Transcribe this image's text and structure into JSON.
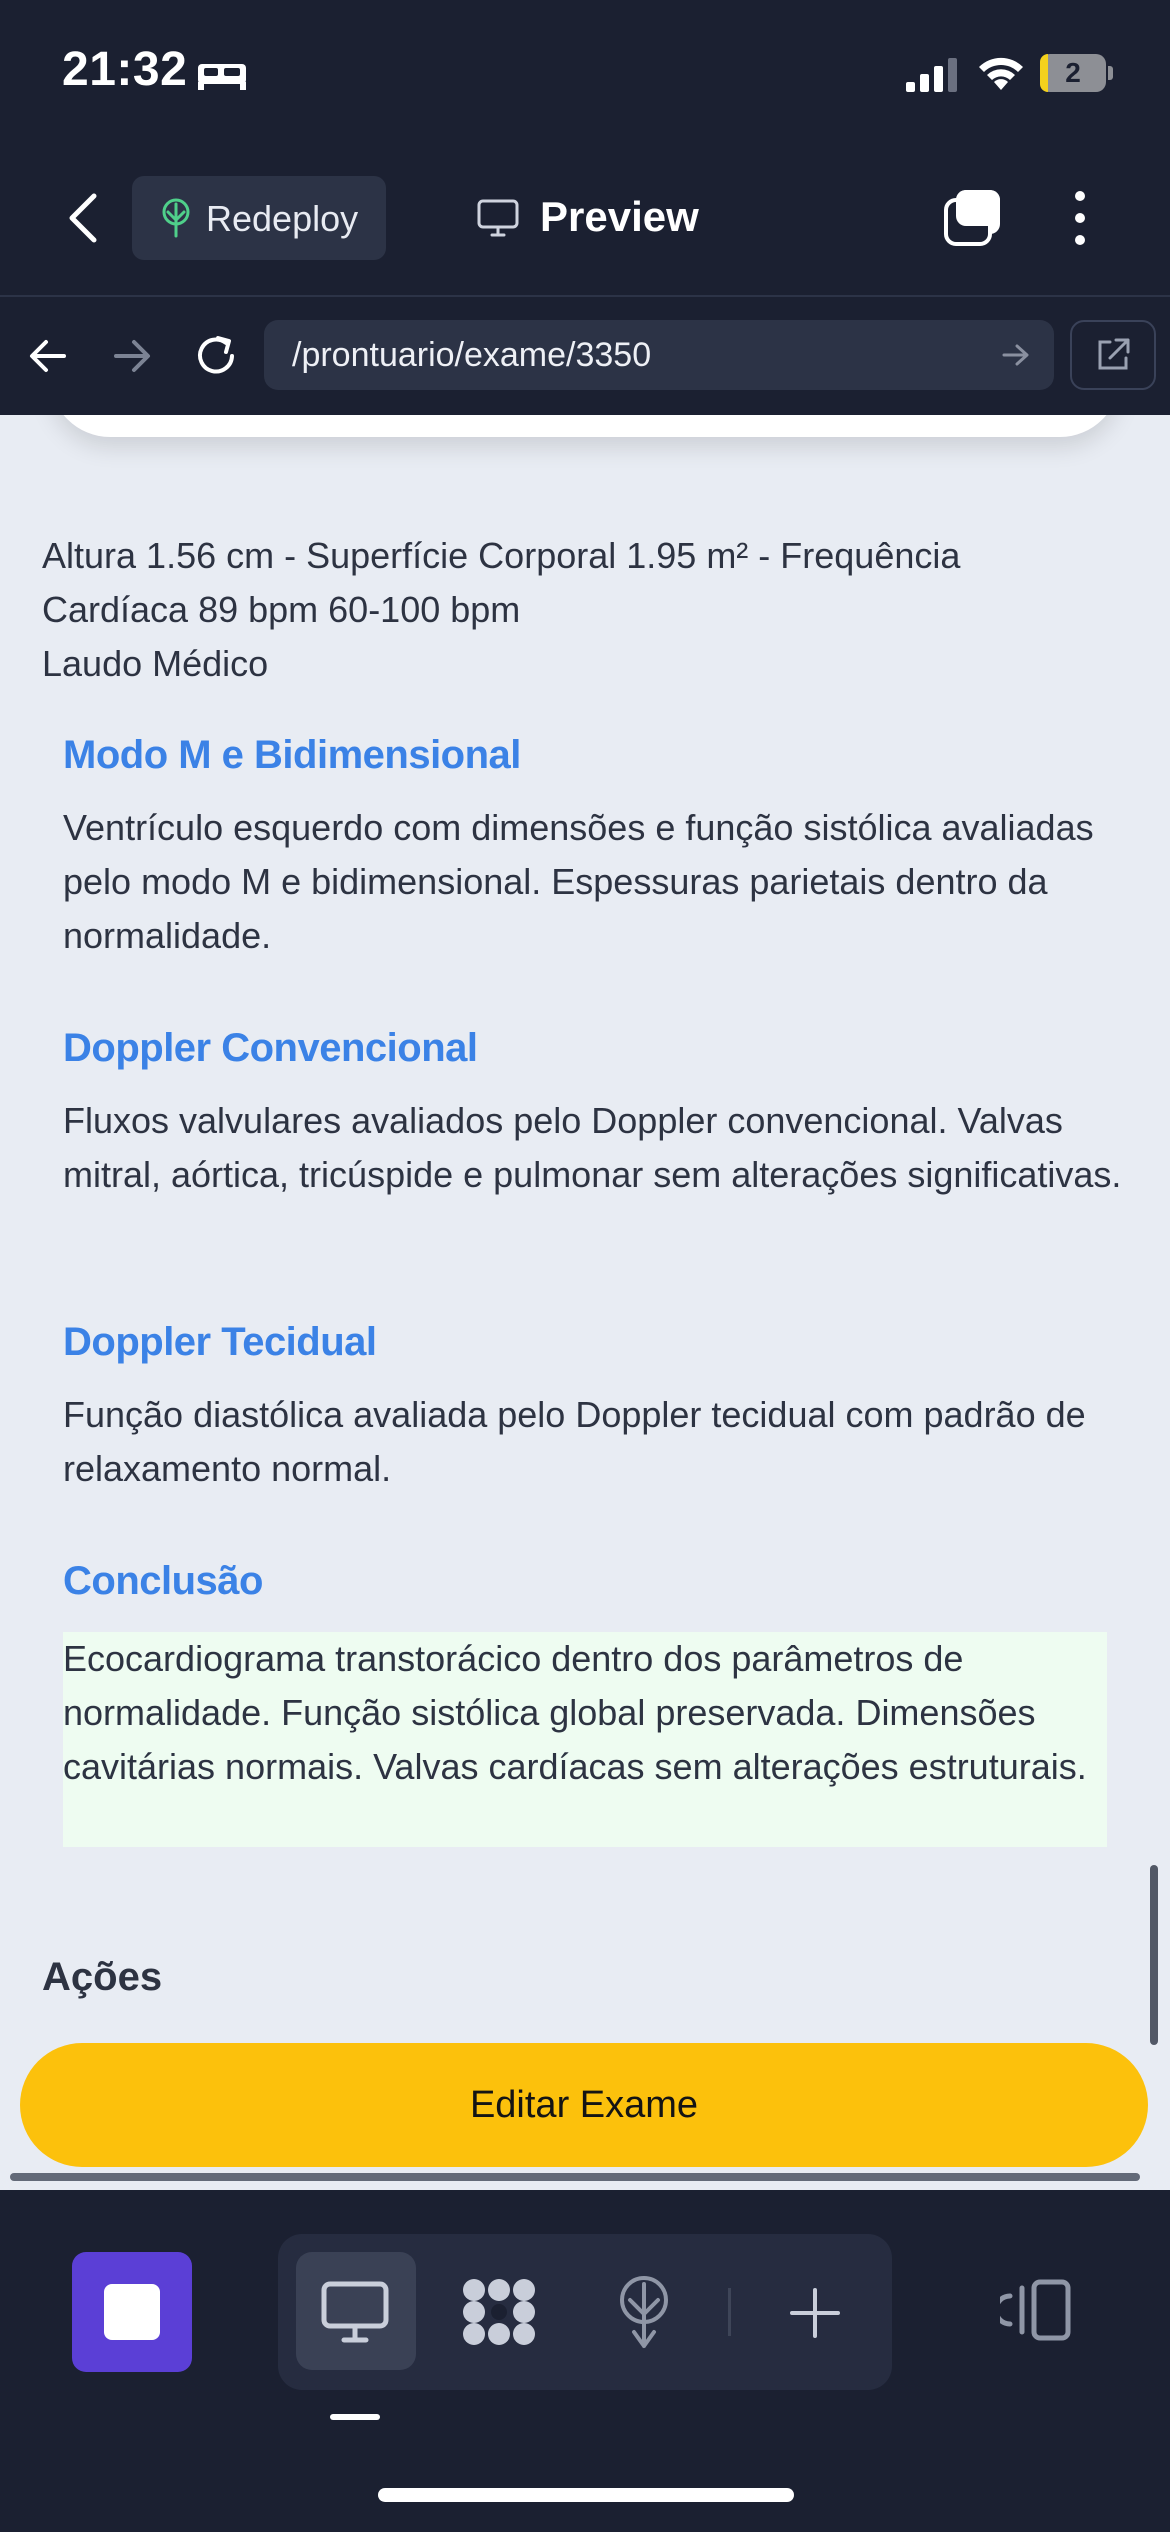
{
  "status_bar": {
    "time": "21:32",
    "battery": "2"
  },
  "app_header": {
    "redeploy_label": "Redeploy",
    "preview_label": "Preview"
  },
  "browser": {
    "url": "/prontuario/exame/3350"
  },
  "report": {
    "info_line_1": "Altura 1.56 cm - Superfície Corporal 1.95 m² - Frequência",
    "info_line_2": "Cardíaca 89 bpm 60-100 bpm",
    "info_line_3": "Laudo Médico",
    "sections": [
      {
        "title": "Modo M e Bidimensional",
        "body": "Ventrículo esquerdo com dimensões e função sistólica avaliadas pelo modo M e bidimensional. Espessuras parietais dentro da normalidade."
      },
      {
        "title": "Doppler Convencional",
        "body": "Fluxos valvulares avaliados pelo Doppler convencional. Valvas mitral, aórtica, tricúspide e pulmonar sem alterações significativas."
      },
      {
        "title": "Doppler Tecidual",
        "body": "Função diastólica avaliada pelo Doppler tecidual com padrão de relaxamento normal."
      },
      {
        "title": "Conclusão",
        "body": "Ecocardiograma transtorácico dentro dos parâmetros de normalidade. Função sistólica global preservada. Dimensões cavitárias normais. Valvas cardíacas sem alterações estruturais."
      }
    ],
    "actions_title": "Ações",
    "edit_button": "Editar Exame"
  },
  "colors": {
    "accent_blue": "#3b82e6",
    "button_yellow": "#fcc10c",
    "stop_purple": "#5b3fd6",
    "dark_bg": "#1b2031"
  }
}
